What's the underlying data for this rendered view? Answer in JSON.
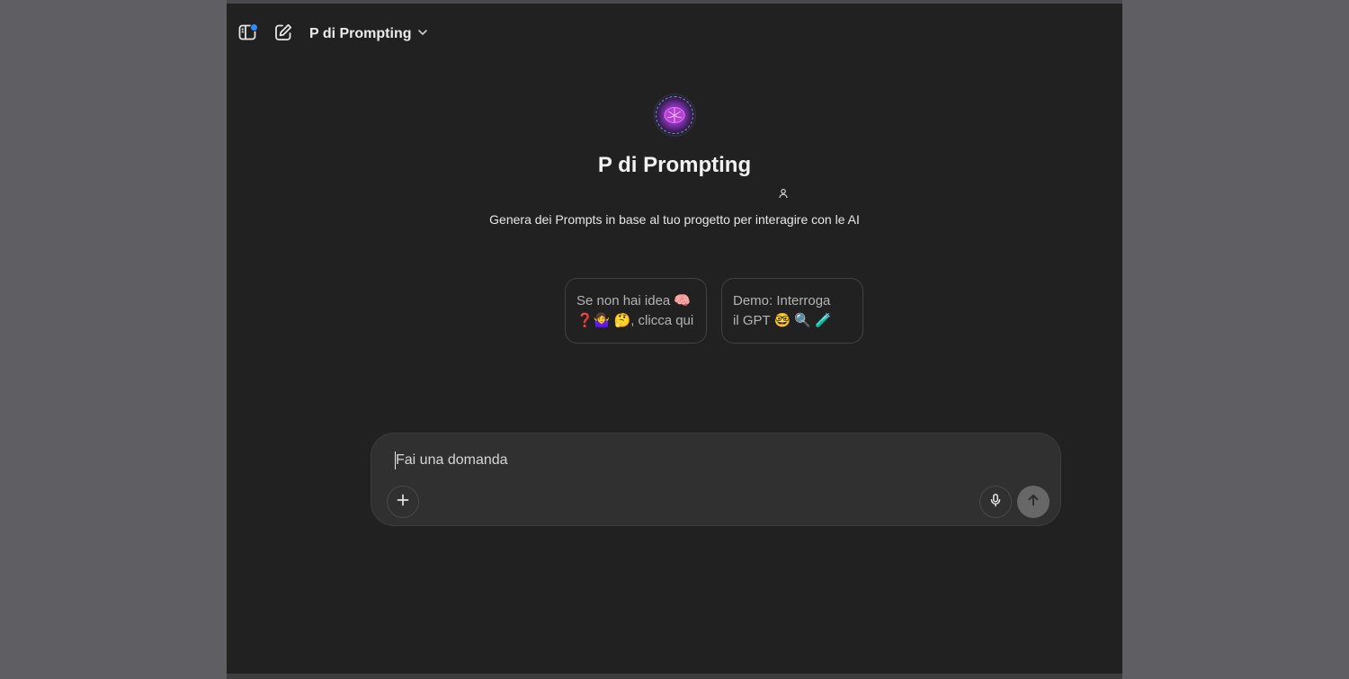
{
  "header": {
    "sidebar_icon": "sidebar-toggle-icon",
    "new_chat_icon": "new-chat-icon",
    "model_name": "P di Prompting"
  },
  "gpt": {
    "avatar_icon": "brain-avatar",
    "title": "P di Prompting",
    "author_icon": "person-icon",
    "description": "Genera dei Prompts in base al tuo progetto per interagire con le AI"
  },
  "starters": [
    {
      "line1": "Se non hai idea 🧠",
      "line2": "❓🤷‍♀️ 🤔, clicca qui"
    },
    {
      "line1": "Demo: Interroga",
      "line2": "il GPT 🤓 🔍 🧪"
    }
  ],
  "composer": {
    "placeholder": "Fai una domanda",
    "attach_icon": "plus-icon",
    "mic_icon": "microphone-icon",
    "send_icon": "arrow-up-icon"
  },
  "colors": {
    "background": "#212121",
    "composer": "#303030",
    "notification_dot": "#2f8cff",
    "send_button": "#676767"
  }
}
